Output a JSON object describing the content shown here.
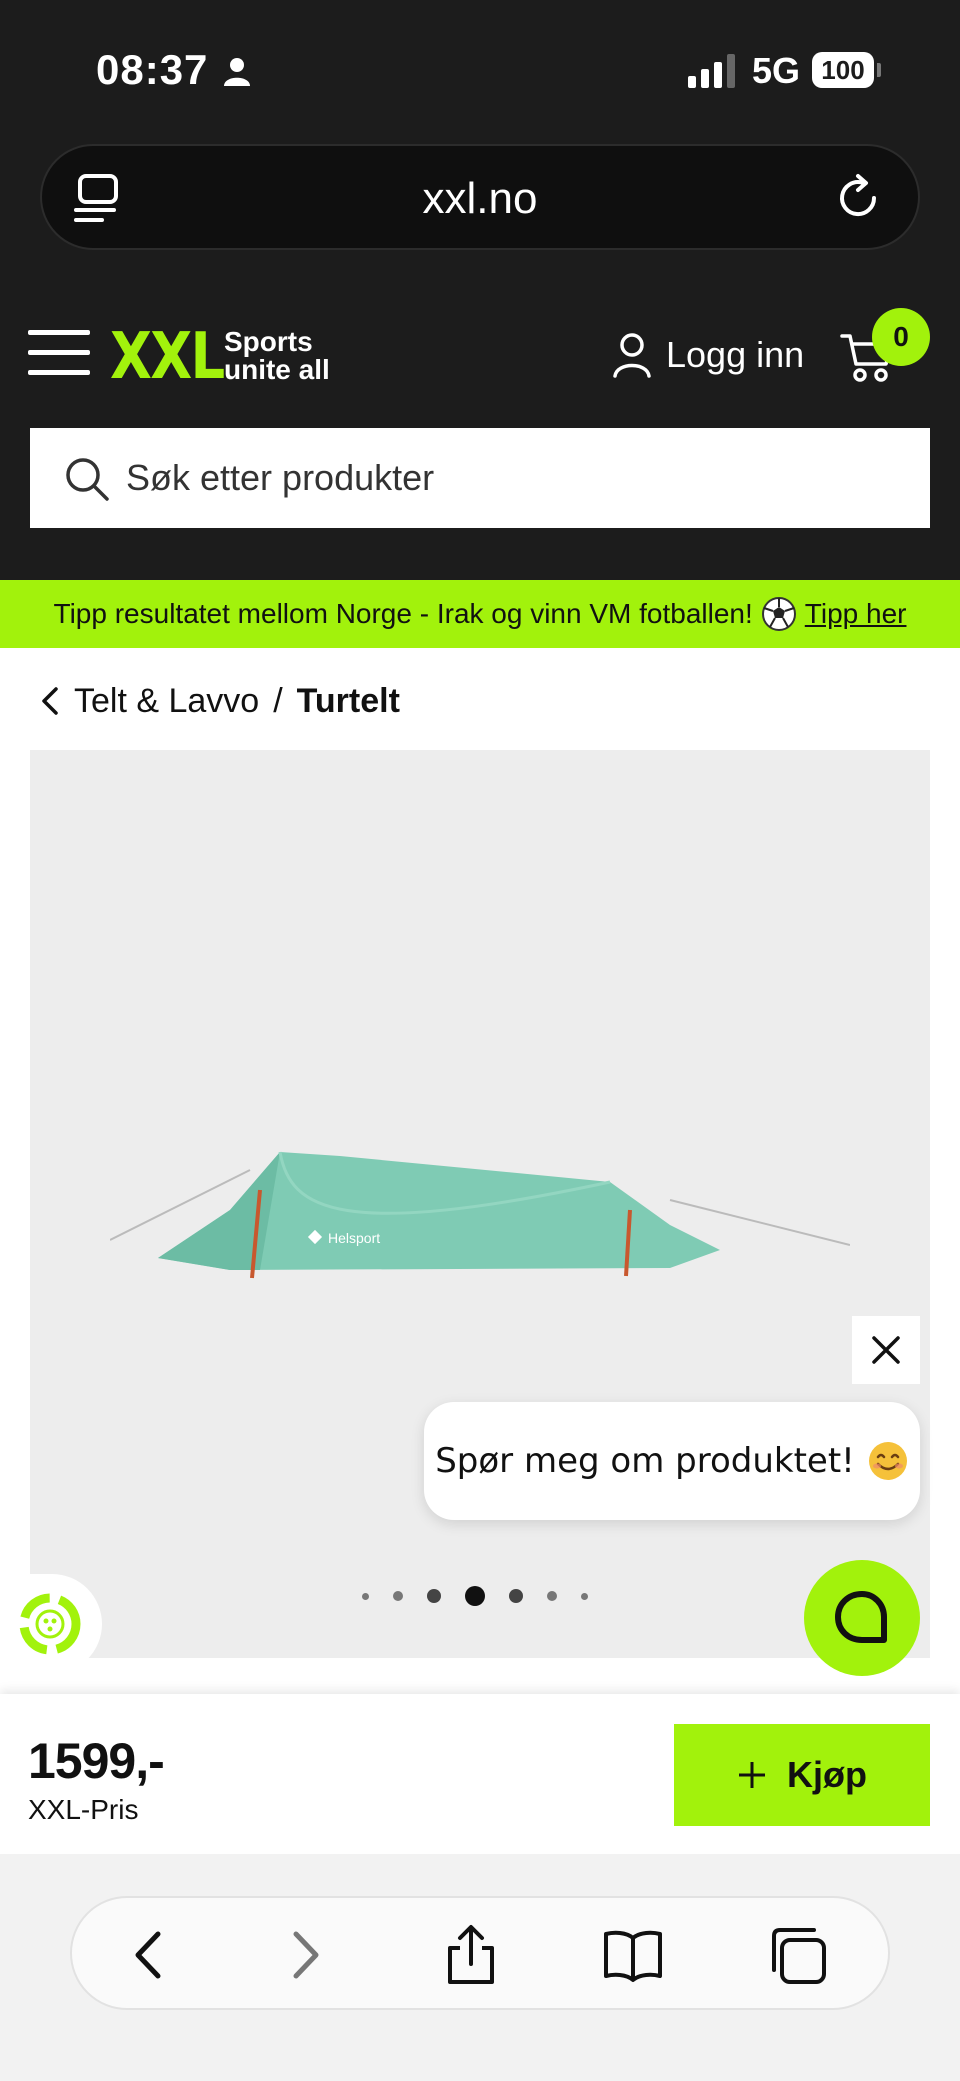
{
  "status_bar": {
    "time": "08:37",
    "network": "5G",
    "battery": "100"
  },
  "browser": {
    "url": "xxl.no"
  },
  "header": {
    "logo": "XXL",
    "tagline_line1": "Sports",
    "tagline_line2": "unite all",
    "login_label": "Logg inn",
    "cart_count": "0",
    "search_placeholder": "Søk etter produkter"
  },
  "promo": {
    "text": "Tipp resultatet mellom Norge - Irak og vinn VM fotballen!",
    "link_label": "Tipp her"
  },
  "breadcrumb": {
    "parent": "Telt & Lavvo",
    "separator": "/",
    "current": "Turtelt"
  },
  "product": {
    "brand_on_image": "Helsport",
    "image_dots_count": 7,
    "active_dot_index": 3,
    "price": "1599,-",
    "price_label": "XXL-Pris",
    "buy_label": "Kjøp"
  },
  "chat": {
    "prompt": "Spør meg om produktet!"
  },
  "colors": {
    "accent": "#a2f20c",
    "dark": "#1c1c1c",
    "tent": "#7fcbb4"
  }
}
